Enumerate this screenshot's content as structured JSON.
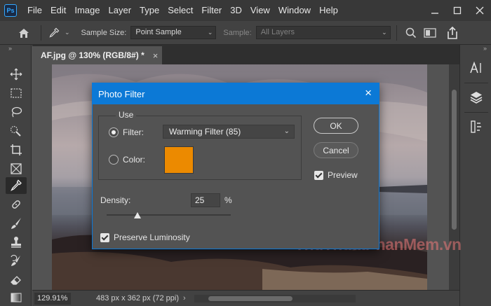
{
  "app": {
    "logo_text": "Ps"
  },
  "menu": [
    "File",
    "Edit",
    "Image",
    "Layer",
    "Type",
    "Select",
    "Filter",
    "3D",
    "View",
    "Window",
    "Help"
  ],
  "options_bar": {
    "sample_size_label": "Sample Size:",
    "sample_size_value": "Point Sample",
    "sample_label": "Sample:",
    "sample_value": "All Layers"
  },
  "document": {
    "tab_title": "AF.jpg @ 130% (RGB/8#) *"
  },
  "status_bar": {
    "zoom": "129.91%",
    "doc_info": "483 px x 362 px (72 ppi)"
  },
  "watermark": "ThuThuatPhanMem.vn",
  "dialog": {
    "title": "Photo Filter",
    "use_legend": "Use",
    "filter_label": "Filter:",
    "filter_value": "Warming Filter (85)",
    "color_label": "Color:",
    "color_value": "#ec8a00",
    "ok_label": "OK",
    "cancel_label": "Cancel",
    "preview_label": "Preview",
    "preview_checked": true,
    "density_label": "Density:",
    "density_value": "25",
    "density_unit": "%",
    "density_fraction": 0.25,
    "preserve_luminosity_label": "Preserve Luminosity",
    "preserve_luminosity_checked": true,
    "selected_mode": "filter"
  },
  "accent_color": "#0c79d6"
}
